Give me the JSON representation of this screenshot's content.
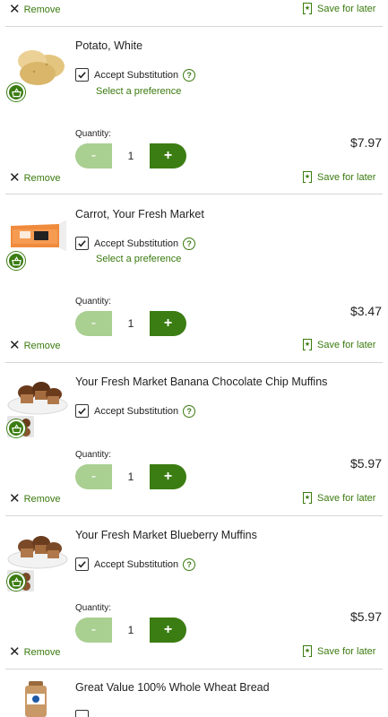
{
  "actions": {
    "remove_label": "Remove",
    "save_label": "Save for later"
  },
  "substitution": {
    "accept_label": "Accept Substitution",
    "help_glyph": "?",
    "preference_label": "Select a preference"
  },
  "quantity": {
    "label": "Quantity:",
    "minus_glyph": "-",
    "plus_glyph": "+"
  },
  "colors": {
    "brand_green": "#3b7d12",
    "disabled_green": "#a9cf91",
    "link_green": "#3a7a0e"
  },
  "items": [
    {
      "name": "Potato, White",
      "qty": "1",
      "price": "$7.97",
      "has_preference": true,
      "image_icon": "potato-image"
    },
    {
      "name": "Carrot, Your Fresh Market",
      "qty": "1",
      "price": "$3.47",
      "has_preference": true,
      "image_icon": "carrot-bag-image"
    },
    {
      "name": "Your Fresh Market Banana Chocolate Chip Muffins",
      "qty": "1",
      "price": "$5.97",
      "has_preference": false,
      "image_icon": "muffins-image"
    },
    {
      "name": "Your Fresh Market Blueberry Muffins",
      "qty": "1",
      "price": "$5.97",
      "has_preference": false,
      "image_icon": "muffins-image"
    },
    {
      "name": "Great Value 100% Whole Wheat Bread",
      "image_icon": "bread-image"
    }
  ]
}
